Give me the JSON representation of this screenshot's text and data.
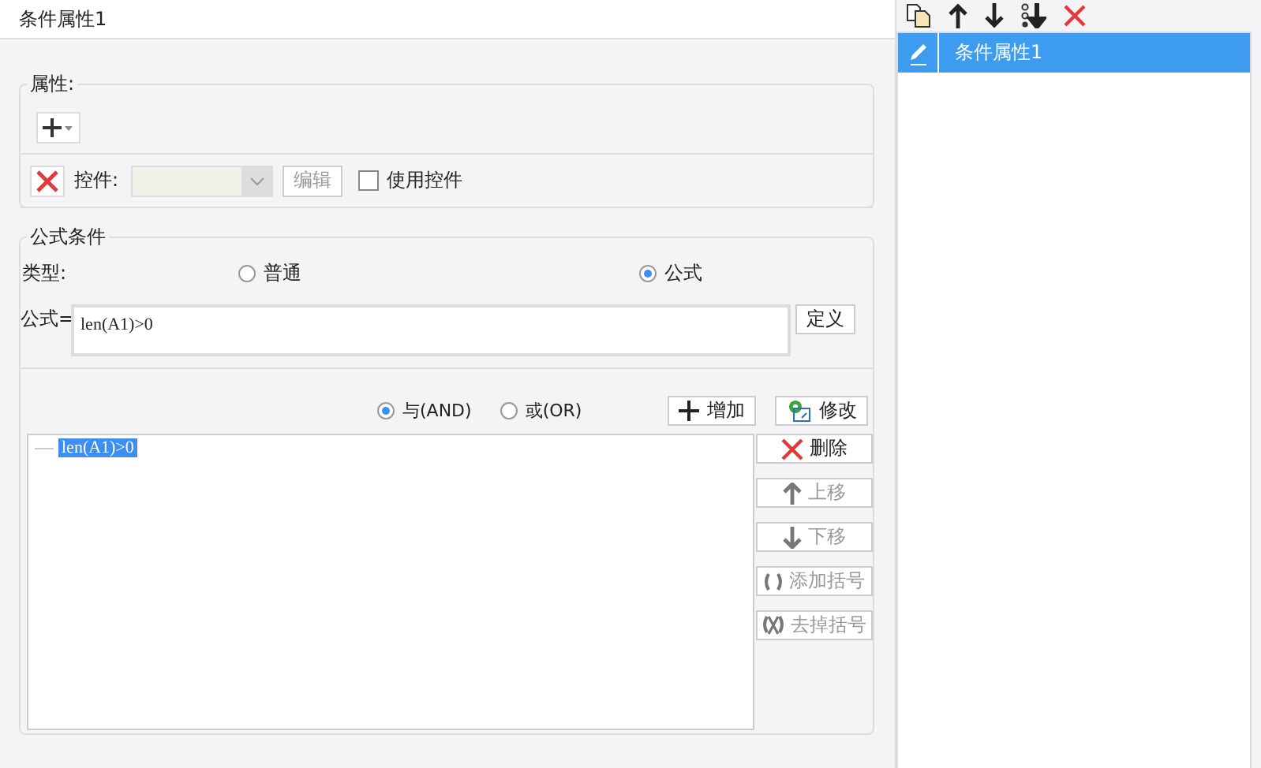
{
  "title": "条件属性1",
  "properties": {
    "legend": "属性:",
    "control_label": "控件:",
    "edit_button": {
      "label": "编辑",
      "disabled": true
    },
    "use_control": {
      "label": "使用控件",
      "checked": false
    }
  },
  "formula_condition": {
    "legend": "公式条件",
    "type_label": "类型:",
    "type_options": [
      {
        "label": "普通",
        "selected": false
      },
      {
        "label": "公式",
        "selected": true
      }
    ],
    "formula_label": "公式=",
    "formula_value": "len(A1)>0",
    "define_button": "定义",
    "logic_options": [
      {
        "label": "与(AND)",
        "selected": true
      },
      {
        "label": "或(OR)",
        "selected": false
      }
    ],
    "add_button": "增加",
    "modify_button": "修改",
    "conditions": [
      {
        "text": "len(A1)>0",
        "selected": true
      }
    ],
    "actions": [
      {
        "kind": "delete",
        "label": "删除",
        "disabled": false
      },
      {
        "kind": "up",
        "label": "上移",
        "disabled": true
      },
      {
        "kind": "down",
        "label": "下移",
        "disabled": true
      },
      {
        "kind": "add-brackets",
        "label": "添加括号",
        "disabled": true
      },
      {
        "kind": "remove-brackets",
        "label": "去掉括号",
        "disabled": true
      }
    ]
  },
  "side_list": [
    {
      "label": "条件属性1",
      "selected": true
    }
  ]
}
